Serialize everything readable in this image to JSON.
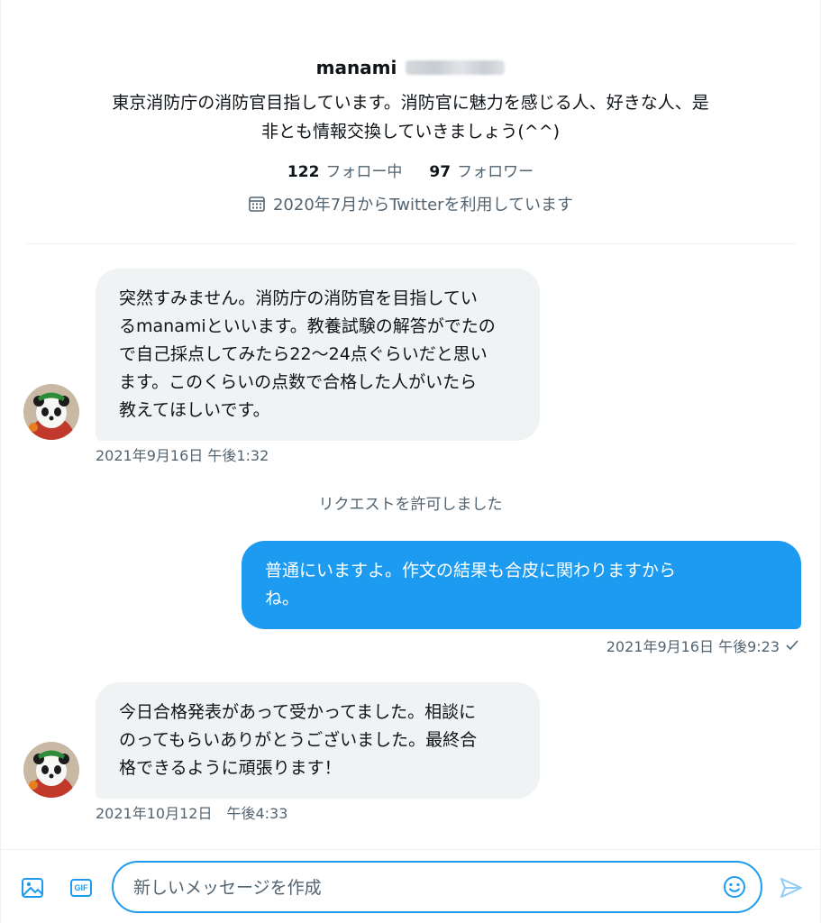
{
  "profile": {
    "name": "manami",
    "bio_lines": [
      "東京消防庁の消防官目指しています。消防官に魅力を感じる人、好きな人、是",
      "非とも情報交換していきましょう(^^)"
    ],
    "following_count": "122",
    "following_label": "フォロー中",
    "followers_count": "97",
    "followers_label": "フォロワー",
    "joined_text": "2020年7月からTwitterを利用しています"
  },
  "messages": [
    {
      "direction": "incoming",
      "lines": [
        "突然すみません。消防庁の消防官を目指してい",
        "るmanamiといいます。教養試験の解答がでたの",
        "で自己採点してみたら22〜24点ぐらいだと思い",
        "ます。このくらいの点数で合格した人がいたら",
        "教えてほしいです。"
      ],
      "timestamp": "2021年9月16日 午後1:32"
    },
    {
      "direction": "outgoing",
      "lines": [
        "普通にいますよ。作文の結果も合皮に関わりますから",
        "ね。"
      ],
      "timestamp": "2021年9月16日 午後9:23"
    },
    {
      "direction": "incoming",
      "lines": [
        "今日合格発表があって受かってました。相談に",
        "のってもらいありがとうございました。最終合",
        "格できるように頑張ります！"
      ],
      "timestamp": "2021年10月12日　午後4:33"
    }
  ],
  "notice": "リクエストを許可しました",
  "composer": {
    "placeholder": "新しいメッセージを作成",
    "gif_label": "GIF"
  },
  "colors": {
    "accent": "#1d9bf0",
    "bubble_incoming": "#eff3f4",
    "secondary_text": "#536471"
  }
}
